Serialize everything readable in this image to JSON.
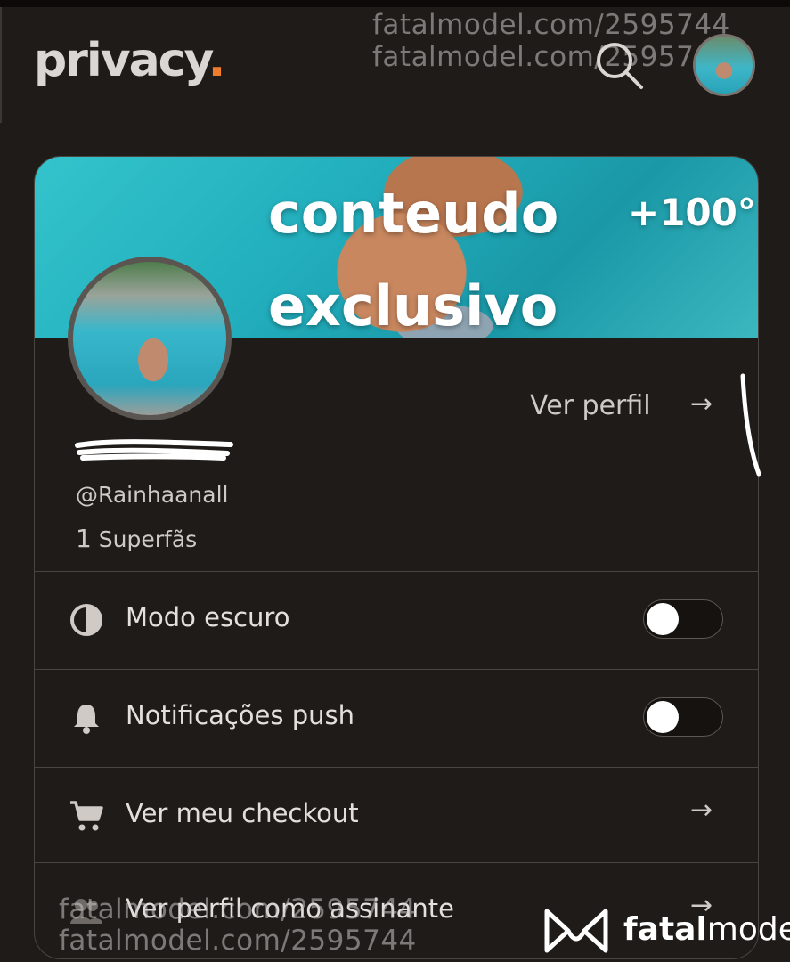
{
  "header": {
    "logo_text": "privacy",
    "logo_dot": ".",
    "accent_color": "#ef7d2e",
    "search_icon": "search-icon",
    "avatar_alt": "user-avatar"
  },
  "watermark": {
    "text": "fatalmodel.com/2595744",
    "brand_light": "fatal",
    "brand_bold": "model"
  },
  "profile": {
    "banner_line1": "conteudo",
    "banner_line2": "exclusivo",
    "banner_count": "+100°",
    "view_profile_label": "Ver perfil",
    "arrow": "→",
    "handle": "@Rainhaanall",
    "fans_count": "1",
    "fans_label": "Superfãs"
  },
  "menu": [
    {
      "label": "Modo escuro",
      "icon": "contrast-icon",
      "control": "toggle",
      "enabled": false
    },
    {
      "label": "Notificações push",
      "icon": "bell-icon",
      "control": "toggle",
      "enabled": false
    },
    {
      "label": "Ver meu checkout",
      "icon": "cart-icon",
      "control": "arrow",
      "arrow": "→"
    },
    {
      "label": "Ver perfil como assinante",
      "icon": "users-icon",
      "control": "arrow",
      "arrow": "→"
    }
  ]
}
